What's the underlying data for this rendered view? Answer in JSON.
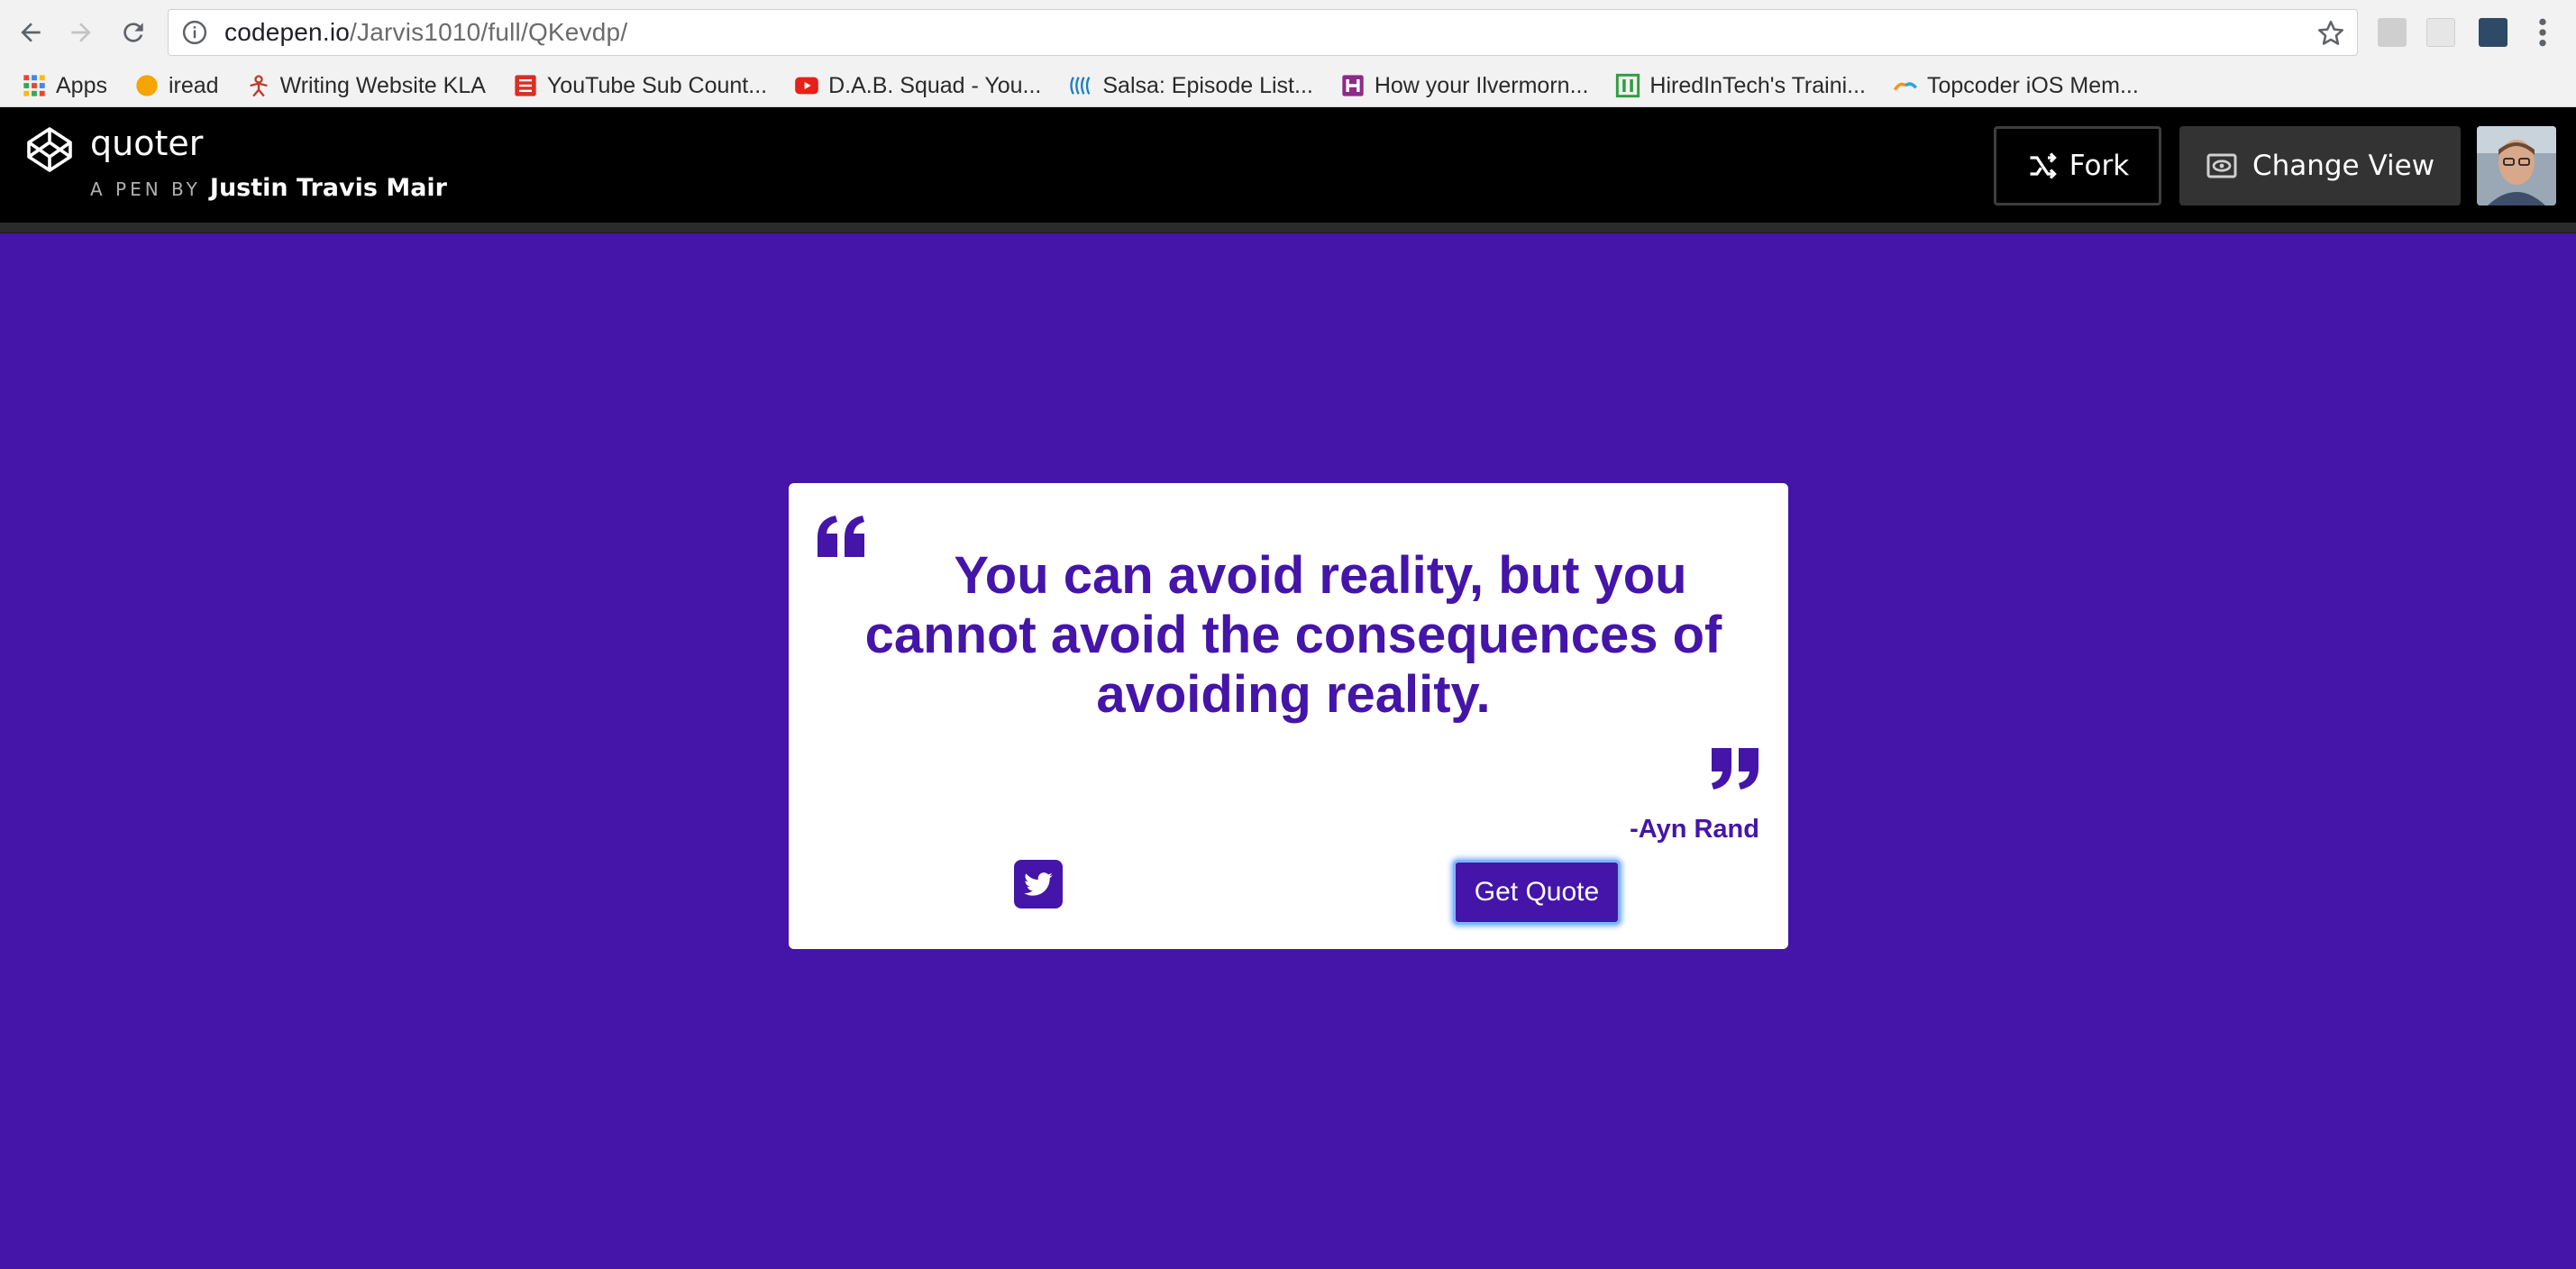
{
  "browser": {
    "url_host": "codepen.io",
    "url_path": "/Jarvis1010/full/QKevdp/",
    "bookmarks": [
      {
        "label": "Apps",
        "icon": "apps-grid-icon"
      },
      {
        "label": "iread",
        "icon": "orange-circle-icon"
      },
      {
        "label": "Writing Website KLA",
        "icon": "figure-icon"
      },
      {
        "label": "YouTube Sub Count...",
        "icon": "yt-sub-counter-icon"
      },
      {
        "label": "D.A.B. Squad - You...",
        "icon": "youtube-icon"
      },
      {
        "label": "Salsa: Episode List...",
        "icon": "salsa-icon"
      },
      {
        "label": "How your Ilvermorn...",
        "icon": "h-badge-icon"
      },
      {
        "label": "HiredInTech's Traini...",
        "icon": "hiredintech-icon"
      },
      {
        "label": "Topcoder iOS Mem...",
        "icon": "topcoder-icon"
      }
    ]
  },
  "codepen": {
    "pen_title": "quoter",
    "byline_prefix": "A PEN BY",
    "author": "Justin Travis Mair",
    "fork_label": "Fork",
    "change_view_label": "Change View"
  },
  "quote": {
    "text": "You can avoid reality, but you cannot avoid the consequences of avoiding reality.",
    "author": "-Ayn Rand",
    "button_label": "Get Quote"
  },
  "colors": {
    "brand_purple": "#4415a8",
    "header_black": "#000000",
    "focus_ring": "#7db6ff"
  }
}
